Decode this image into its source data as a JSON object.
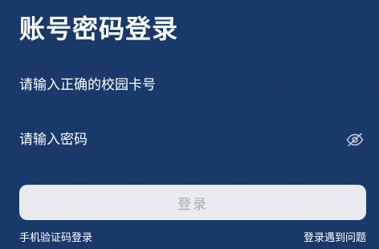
{
  "page": {
    "title": "账号密码登录"
  },
  "form": {
    "student_id": {
      "value": "",
      "placeholder": "请输入正确的校园卡号"
    },
    "password": {
      "value": "",
      "placeholder": "请输入密码",
      "visibility_icon": "eye-off-icon"
    },
    "submit_label": "登录"
  },
  "links": {
    "sms_login": "手机验证码登录",
    "login_help": "登录遇到问题"
  },
  "colors": {
    "background": "#18396a",
    "button_background": "#e9ebef",
    "button_text": "#a6abb3",
    "text": "#ffffff"
  }
}
